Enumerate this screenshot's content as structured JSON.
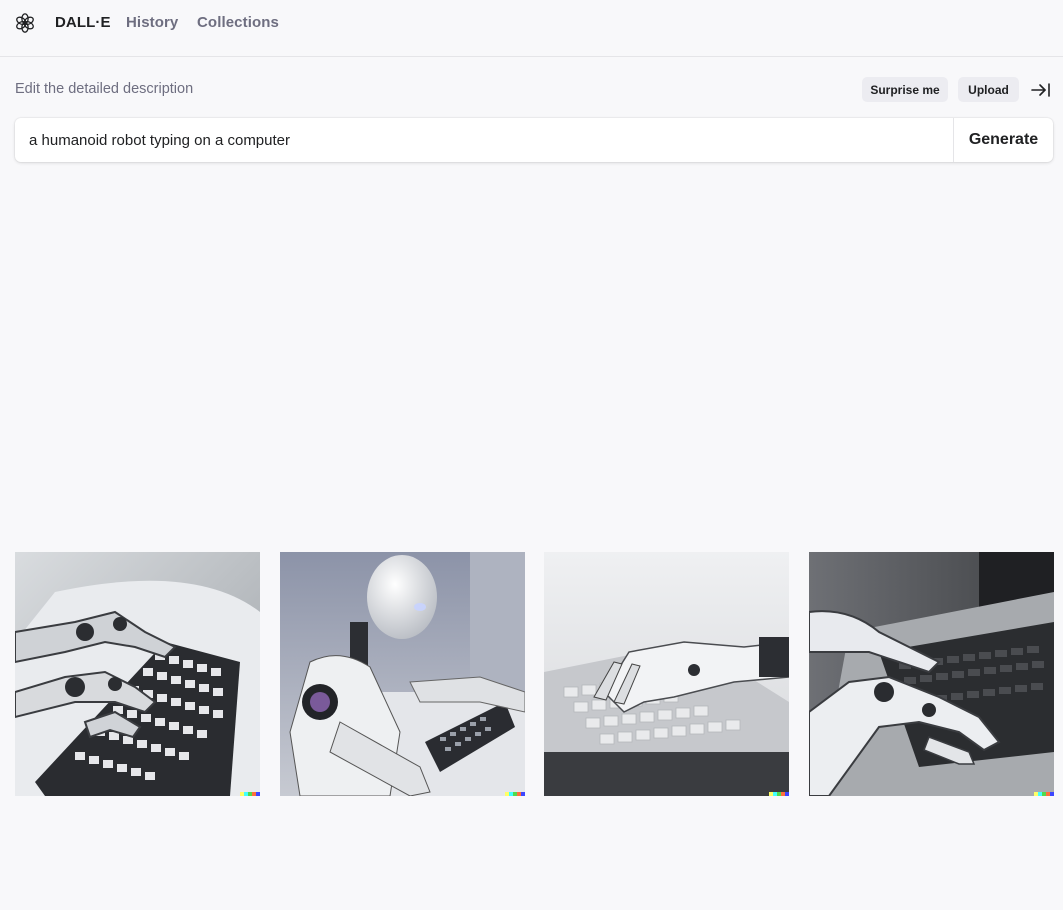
{
  "nav": {
    "brand": "DALL·E",
    "history": "History",
    "collections": "Collections"
  },
  "prompt": {
    "hint": "Edit the detailed description",
    "value": "a humanoid robot typing on a computer",
    "surprise_label": "Surprise me",
    "upload_label": "Upload",
    "generate_label": "Generate"
  },
  "icons": {
    "logo": "openai-logo-icon",
    "collapse": "arrow-right-to-bar-icon"
  },
  "signature_colors": [
    "#ffff66",
    "#42ffff",
    "#51da4c",
    "#ff6e3c",
    "#3c46ff"
  ],
  "results": [
    {
      "name": "result-image-1",
      "subject": "robot hands on keyboard"
    },
    {
      "name": "result-image-2",
      "subject": "humanoid robot at laptop"
    },
    {
      "name": "result-image-3",
      "subject": "robot hand on laptop keyboard"
    },
    {
      "name": "result-image-4",
      "subject": "robot hand typing on laptop"
    }
  ]
}
